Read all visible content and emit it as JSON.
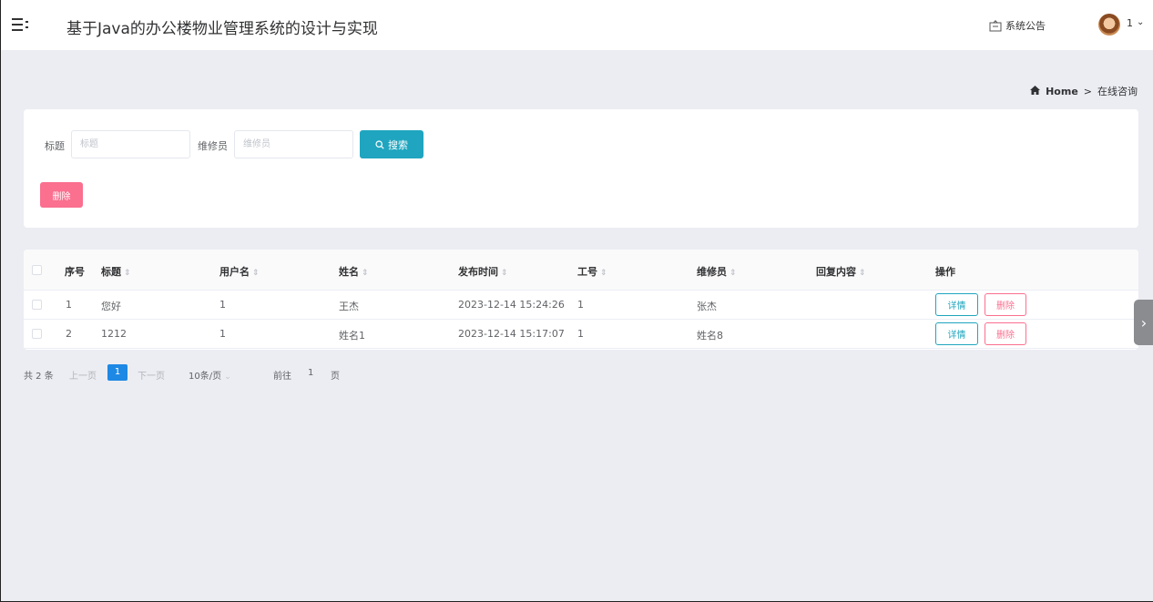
{
  "header": {
    "title": "基于Java的办公楼物业管理系统的设计与实现",
    "notice_label": "系统公告",
    "user_name": "1"
  },
  "breadcrumb": {
    "home": "Home",
    "separator": ">",
    "current": "在线咨询"
  },
  "search": {
    "title_label": "标题",
    "title_placeholder": "标题",
    "repairman_label": "维修员",
    "repairman_placeholder": "维修员",
    "search_button": "搜索",
    "delete_button": "删除"
  },
  "table": {
    "columns": [
      "序号",
      "标题",
      "用户名",
      "姓名",
      "发布时间",
      "工号",
      "维修员",
      "回复内容",
      "操作"
    ],
    "rows": [
      {
        "index": "1",
        "title": "您好",
        "username": "1",
        "name": "王杰",
        "time": "2023-12-14 15:24:26",
        "job_no": "1",
        "repairman": "张杰",
        "reply": "",
        "detail": "详情",
        "delete": "删除"
      },
      {
        "index": "2",
        "title": "1212",
        "username": "1",
        "name": "姓名1",
        "time": "2023-12-14 15:17:07",
        "job_no": "1",
        "repairman": "姓名8",
        "reply": "",
        "detail": "详情",
        "delete": "删除"
      }
    ]
  },
  "pagination": {
    "total": "共 2 条",
    "prev": "上一页",
    "current_page": "1",
    "next": "下一页",
    "page_size": "10条/页",
    "goto_prefix": "前往",
    "goto_value": "1",
    "goto_suffix": "页"
  },
  "colors": {
    "accent": "#1fa5bf",
    "danger": "#fb6f8f",
    "page_active": "#1e88e5",
    "background": "#ecedf3"
  }
}
